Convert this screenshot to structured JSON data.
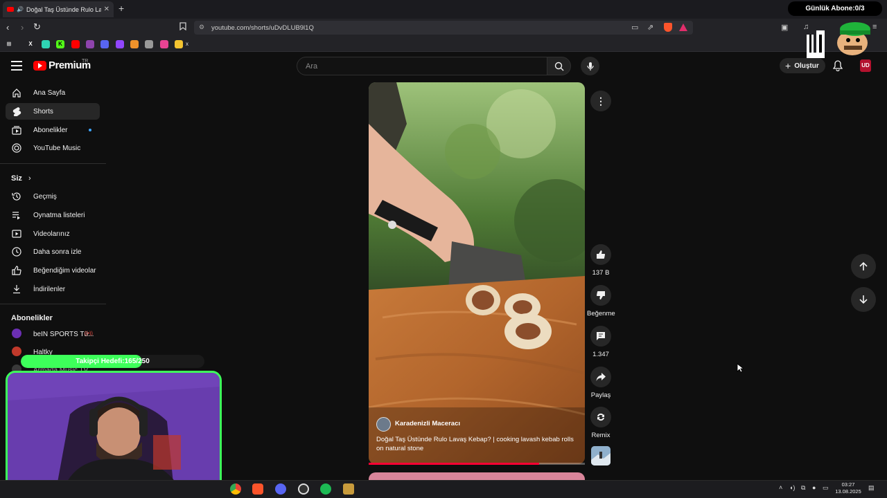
{
  "browser": {
    "tab_title": "Doğal Taş Üstünde Rulo Lava...",
    "tab_close": "✕",
    "new_tab": "+",
    "url": "youtube.com/shorts/uDvDLUB9l1Q",
    "bookmark_last_label": "x"
  },
  "overlay": {
    "sub_counter": "Günlük Abone:0/3",
    "follower_goal": "Takipçi Hedefi:165/250",
    "follower_goal_fraction": 0.66
  },
  "header": {
    "brand": "Premium",
    "region": "TR",
    "search_placeholder": "Ara",
    "create_label": "Oluştur"
  },
  "sidebar": {
    "main": [
      {
        "label": "Ana Sayfa"
      },
      {
        "label": "Shorts"
      },
      {
        "label": "Abonelikler"
      },
      {
        "label": "YouTube Music"
      }
    ],
    "you_header": "Siz",
    "you_chevron": "›",
    "you": [
      {
        "label": "Geçmiş"
      },
      {
        "label": "Oynatma listeleri"
      },
      {
        "label": "Videolarınız"
      },
      {
        "label": "Daha sonra izle"
      },
      {
        "label": "Beğendiğim videolar"
      },
      {
        "label": "İndirilenler"
      }
    ],
    "subs_header": "Abonelikler",
    "subs": [
      {
        "label": "beIN SPORTS Tü..."
      },
      {
        "label": "Haltky"
      },
      {
        "label": "Armada Music TV"
      }
    ]
  },
  "short": {
    "channel": "Karadenizli Maceracı",
    "caption": "Doğal Taş Üstünde Rulo Lavaş Kebap? | cooking lavash kebab rolls on natural stone",
    "progress_fraction": 0.79,
    "likes": "137 B",
    "dislike_label": "Beğenme",
    "comments": "1.347",
    "share_label": "Paylaş",
    "remix_label": "Remix"
  },
  "taskbar": {
    "time": "03:27",
    "date": "13.08.2025"
  },
  "colors": {
    "yt_red": "#ff0000",
    "goal_green": "#3dff5a",
    "progress_red": "#ff0033"
  }
}
